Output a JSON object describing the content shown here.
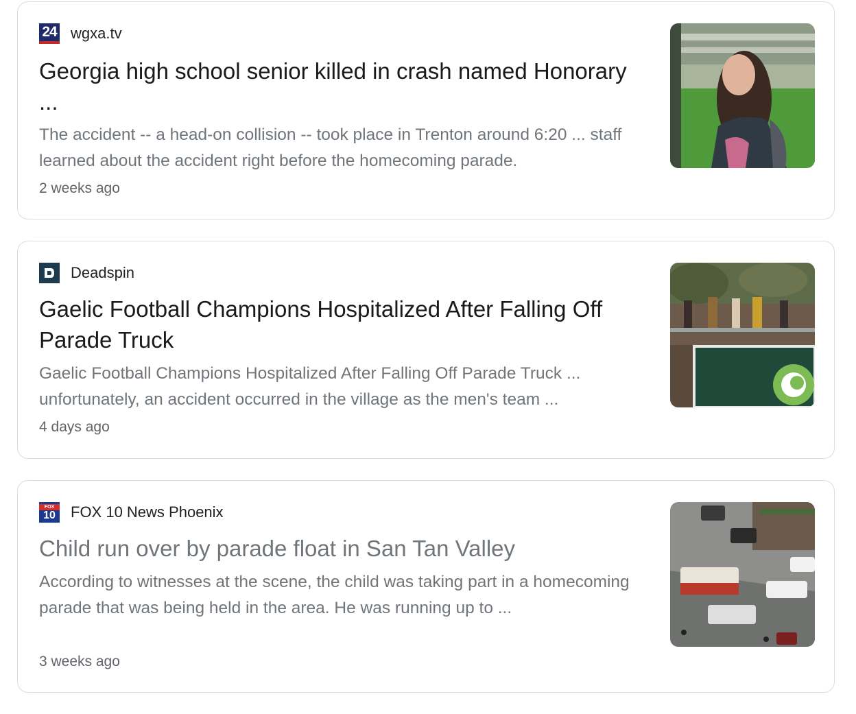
{
  "results": [
    {
      "source": "wgxa.tv",
      "favicon": "channel-24-logo-icon",
      "favicon_text": "24",
      "title": "Georgia high school senior killed in crash named Honorary ...",
      "snippet": "The accident -- a head-on collision -- took place in Trenton around 6:20 ... staff learned about the accident right before the homecoming parade.",
      "age": "2 weeks ago",
      "thumbnail": "student-portrait-image",
      "visited": false
    },
    {
      "source": "Deadspin",
      "favicon": "deadspin-d-logo-icon",
      "title": "Gaelic Football Champions Hospitalized After Falling Off Parade Truck",
      "snippet": "Gaelic Football Champions Hospitalized After Falling Off Parade Truck ... unfortunately, an accident occurred in the village as the men's team ...",
      "age": "4 days ago",
      "thumbnail": "parade-truck-crowd-image",
      "visited": false
    },
    {
      "source": "FOX 10 News Phoenix",
      "favicon": "fox-10-logo-icon",
      "favicon_top": "FOX",
      "favicon_text": "10",
      "title": "Child run over by parade float in San Tan Valley",
      "snippet": "According to witnesses at the scene, the child was taking part in a homecoming parade that was being held in the area. He was running up to ...",
      "age": "3 weeks ago",
      "thumbnail": "aerial-emergency-vehicles-image",
      "visited": true
    }
  ],
  "colors": {
    "title": "#1a1a1a",
    "visited_title": "#70757a",
    "snippet": "#70757a",
    "card_border": "#dadce0"
  }
}
